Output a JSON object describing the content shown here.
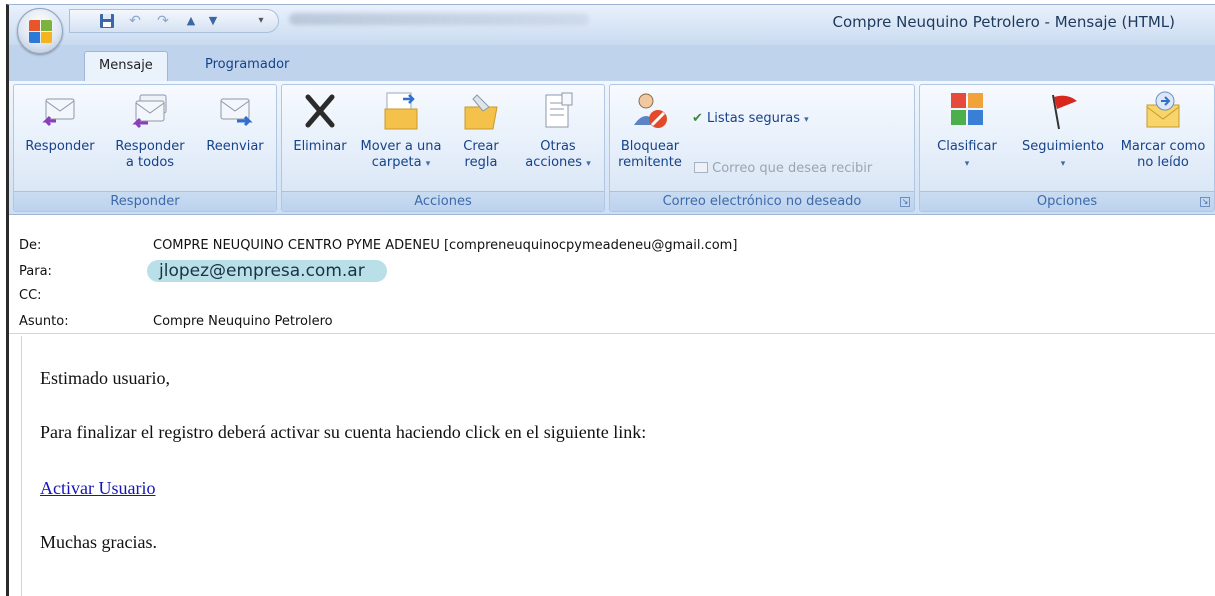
{
  "window_title": "Compre Neuquino Petrolero - Mensaje (HTML)",
  "tabs": [
    "Mensaje",
    "Programador"
  ],
  "ribbon": {
    "groups": {
      "responder": {
        "label": "Responder",
        "buttons": [
          {
            "label1": "Responder",
            "label2": "",
            "icon": "reply-icon"
          },
          {
            "label1": "Responder",
            "label2": "a todos",
            "icon": "reply-all-icon"
          },
          {
            "label1": "Reenviar",
            "label2": "",
            "icon": "forward-icon"
          }
        ]
      },
      "acciones": {
        "label": "Acciones",
        "buttons": [
          {
            "label1": "Eliminar",
            "label2": "",
            "icon": "delete-icon"
          },
          {
            "label1": "Mover a una",
            "label2": "carpeta",
            "icon": "move-folder-icon"
          },
          {
            "label1": "Crear",
            "label2": "regla",
            "icon": "create-rule-icon"
          },
          {
            "label1": "Otras",
            "label2": "acciones",
            "icon": "other-actions-icon"
          }
        ]
      },
      "junk": {
        "label": "Correo electrónico no deseado",
        "block_label1": "Bloquear",
        "block_label2": "remitente",
        "safe_lists": "Listas seguras",
        "wanted": "Correo que desea recibir"
      },
      "opciones": {
        "label": "Opciones",
        "buttons": [
          {
            "label1": "Clasificar",
            "label2": "",
            "icon": "categorize-icon"
          },
          {
            "label1": "Seguimiento",
            "label2": "",
            "icon": "follow-up-flag-icon"
          },
          {
            "label1": "Marcar como",
            "label2": "no leído",
            "icon": "mark-unread-icon"
          }
        ]
      }
    }
  },
  "headers": {
    "from_label": "De:",
    "from_value": "COMPRE NEUQUINO CENTRO PYME ADENEU [compreneuquinocpymeadeneu@gmail.com]",
    "to_label": "Para:",
    "to_value": "jlopez@empresa.com.ar",
    "cc_label": "CC:",
    "subject_label": "Asunto:",
    "subject_value": "Compre Neuquino Petrolero"
  },
  "body": {
    "greeting": "Estimado usuario,",
    "line1": "Para finalizar el registro deberá activar su cuenta haciendo click en el siguiente link:",
    "link": "Activar Usuario",
    "closing": "Muchas gracias."
  },
  "colors": {
    "ribbon_text": "#15428b",
    "link": "#1414b8",
    "recipient_chip": "#b9dfe8"
  }
}
